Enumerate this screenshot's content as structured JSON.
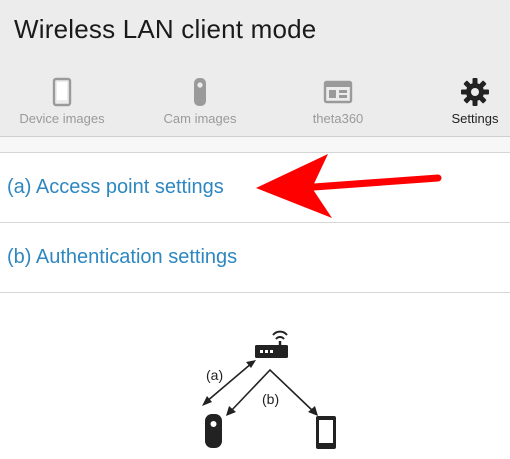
{
  "app": {
    "title": "Wireless LAN client mode"
  },
  "tabs": [
    {
      "label": "Device images",
      "icon": "phone-icon",
      "active": false
    },
    {
      "label": "Cam images",
      "icon": "camera-icon",
      "active": false
    },
    {
      "label": "theta360",
      "icon": "window-icon",
      "active": false
    },
    {
      "label": "Settings",
      "icon": "gear-icon",
      "active": true
    }
  ],
  "menu": {
    "items": [
      {
        "label": "(a) Access point settings"
      },
      {
        "label": "(b) Authentication settings"
      }
    ]
  },
  "diagram": {
    "label_a": "(a)",
    "label_b": "(b)",
    "icons": [
      "router-icon",
      "camera-icon",
      "smartphone-icon"
    ]
  },
  "colors": {
    "accent": "#2e87c0",
    "annotation_arrow": "#ff0000",
    "header_bg": "#ececec"
  }
}
